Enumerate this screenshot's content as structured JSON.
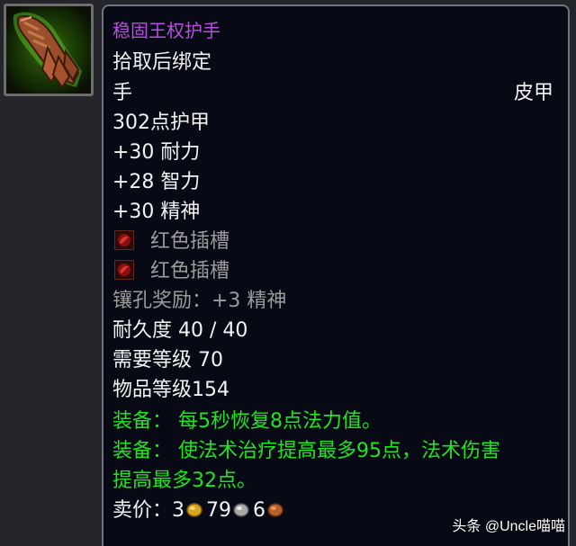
{
  "item": {
    "name": "稳固王权护手",
    "binding": "拾取后绑定",
    "slot": "手",
    "armor_type": "皮甲",
    "armor": "302点护甲",
    "stats": [
      "+30 耐力",
      "+28 智力",
      "+30 精神"
    ],
    "sockets": [
      {
        "label": "红色插槽",
        "icon": "red-socket-icon"
      },
      {
        "label": "红色插槽",
        "icon": "red-socket-icon"
      }
    ],
    "socket_bonus": "镶孔奖励：+3 精神",
    "durability": "耐久度 40 / 40",
    "required_level": "需要等级 70",
    "item_level": "物品等级154",
    "equip_effects": [
      "装备：  每5秒恢复8点法力值。",
      "装备：  使法术治疗提高最多95点，法术伤害",
      "提高最多32点。"
    ],
    "sell_price": {
      "label": "卖价：",
      "gold": "3",
      "silver": "79",
      "copper": "6"
    }
  },
  "icon": "leather-gauntlets-icon",
  "colors": {
    "title": "#b64fdf",
    "text": "#f2f2f2",
    "gray": "#9b9b9b",
    "green": "#1ee51e",
    "background": "#070a15",
    "border": "#6f7480"
  },
  "watermark": "头条 @Uncle喵喵"
}
